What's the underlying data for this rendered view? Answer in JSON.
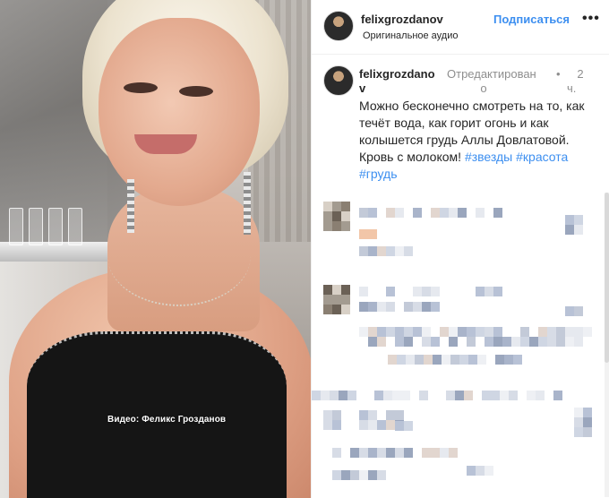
{
  "post": {
    "header": {
      "username": "felixgrozdanov",
      "audio": "Оригинальное аудио",
      "follow_label": "Подписаться",
      "more_label": "•••"
    },
    "caption": {
      "username_line1": "felixgrozdano",
      "username_line2": "v",
      "edited_line1": "Отредактирован",
      "edited_line2": "о",
      "separator": "•",
      "time_line1": "2",
      "time_line2": "ч.",
      "text": "Можно бесконечно смотреть на то, как течёт вода, как горит огонь и как колышется грудь Аллы Довлатовой. Кровь с молоком! ",
      "hashtags": [
        "#звезды",
        "#красота",
        "#грудь"
      ]
    }
  },
  "media": {
    "watermark": "Видео: Феликс Грозданов"
  },
  "colors": {
    "link_blue": "#3d8ff0",
    "text_dark": "#262626",
    "text_muted": "#8e8e8e"
  },
  "icons": {
    "avatar": "profile-photo",
    "more": "ellipsis-icon"
  }
}
